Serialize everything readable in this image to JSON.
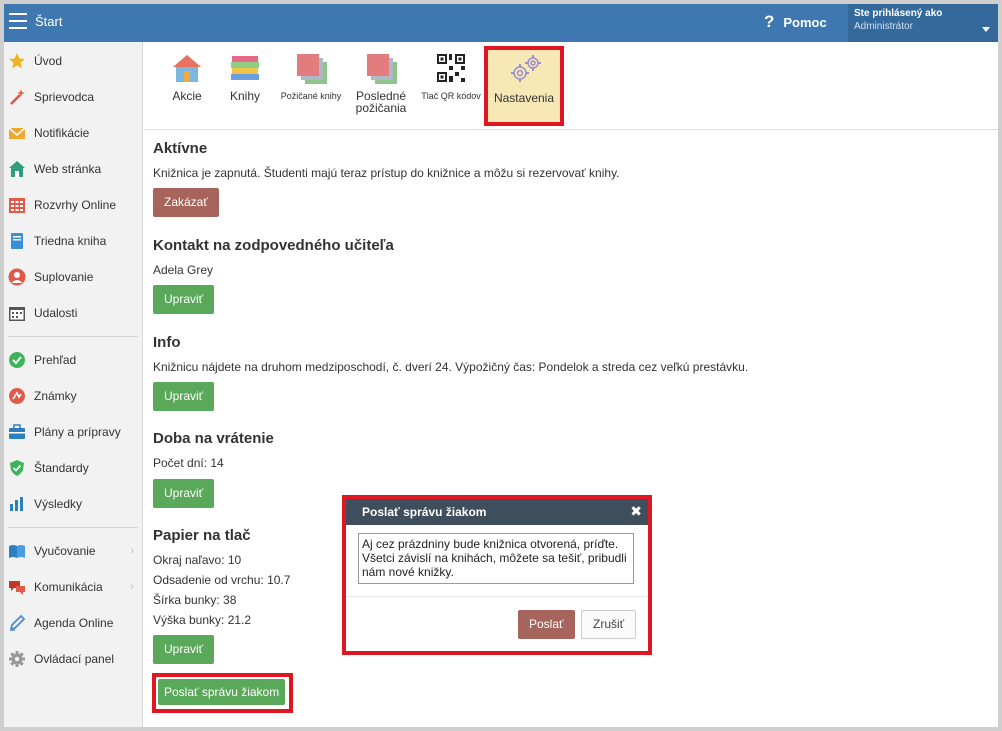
{
  "header": {
    "title": "Štart",
    "help_label": "Pomoc",
    "user_line1": "Ste prihlásený ako",
    "user_line2": "Administrátor"
  },
  "sidebar": {
    "group1": [
      {
        "label": "Úvod",
        "icon": "star-icon"
      },
      {
        "label": "Sprievodca",
        "icon": "magic-wand-icon"
      },
      {
        "label": "Notifikácie",
        "icon": "envelope-icon"
      },
      {
        "label": "Web stránka",
        "icon": "house-icon"
      },
      {
        "label": "Rozvrhy Online",
        "icon": "timetable-icon"
      },
      {
        "label": "Triedna kniha",
        "icon": "book-icon"
      },
      {
        "label": "Suplovanie",
        "icon": "person-icon"
      },
      {
        "label": "Udalosti",
        "icon": "calendar-icon"
      }
    ],
    "group2": [
      {
        "label": "Prehľad",
        "icon": "check-circle-icon"
      },
      {
        "label": "Známky",
        "icon": "grade-icon"
      },
      {
        "label": "Plány a prípravy",
        "icon": "briefcase-icon"
      },
      {
        "label": "Štandardy",
        "icon": "shield-check-icon"
      },
      {
        "label": "Výsledky",
        "icon": "bar-chart-icon"
      }
    ],
    "group3": [
      {
        "label": "Vyučovanie",
        "icon": "open-book-icon"
      },
      {
        "label": "Komunikácia",
        "icon": "chat-icon"
      },
      {
        "label": "Agenda Online",
        "icon": "pen-icon"
      },
      {
        "label": "Ovládací panel",
        "icon": "gear-icon"
      }
    ]
  },
  "toolbar": {
    "items": [
      {
        "label": "Akcie",
        "icon": "home-icon"
      },
      {
        "label": "Knihy",
        "icon": "books-stack-icon"
      },
      {
        "label": "Požičané knihy",
        "icon": "borrowed-books-icon"
      },
      {
        "label": "Posledné požičania",
        "icon": "recent-loans-icon"
      },
      {
        "label": "Tlač QR kódov",
        "icon": "qr-code-icon"
      },
      {
        "label": "Nastavenia",
        "icon": "gears-icon"
      }
    ]
  },
  "sections": {
    "active": {
      "title": "Aktívne",
      "text": "Knižnica je zapnutá. Študenti majú teraz prístup do knižnice a môžu si rezervovať knihy.",
      "button": "Zakázať"
    },
    "contact": {
      "title": "Kontakt na zodpovedného učiteľa",
      "text": "Adela Grey",
      "button": "Upraviť"
    },
    "info": {
      "title": "Info",
      "text": "Knižnicu nájdete na druhom medziposchodí, č. dverí 24. Výpožičný čas: Pondelok a streda cez veľkú prestávku.",
      "button": "Upraviť"
    },
    "return": {
      "title": "Doba na vrátenie",
      "text": "Počet dní: 14",
      "button": "Upraviť"
    },
    "paper": {
      "title": "Papier na tlač",
      "lines": [
        "Okraj naľavo: 10",
        "Odsadenie od vrchu: 10.7",
        "Šírka bunky: 38",
        "Výška bunky: 21.2"
      ],
      "button": "Upraviť"
    },
    "send_button": "Poslať správu žiakom"
  },
  "modal": {
    "title": "Poslať správu žiakom",
    "message": "Aj cez prázdniny bude knižnica otvorená, príďte. Všetci závislí na knihách, môžete sa tešiť, pribudli nám nové knižky.",
    "send": "Poslať",
    "cancel": "Zrušiť"
  },
  "colors": {
    "header": "#3f78b0",
    "green": "#5aa85a",
    "brown": "#a6645c",
    "highlight": "#e01622"
  }
}
